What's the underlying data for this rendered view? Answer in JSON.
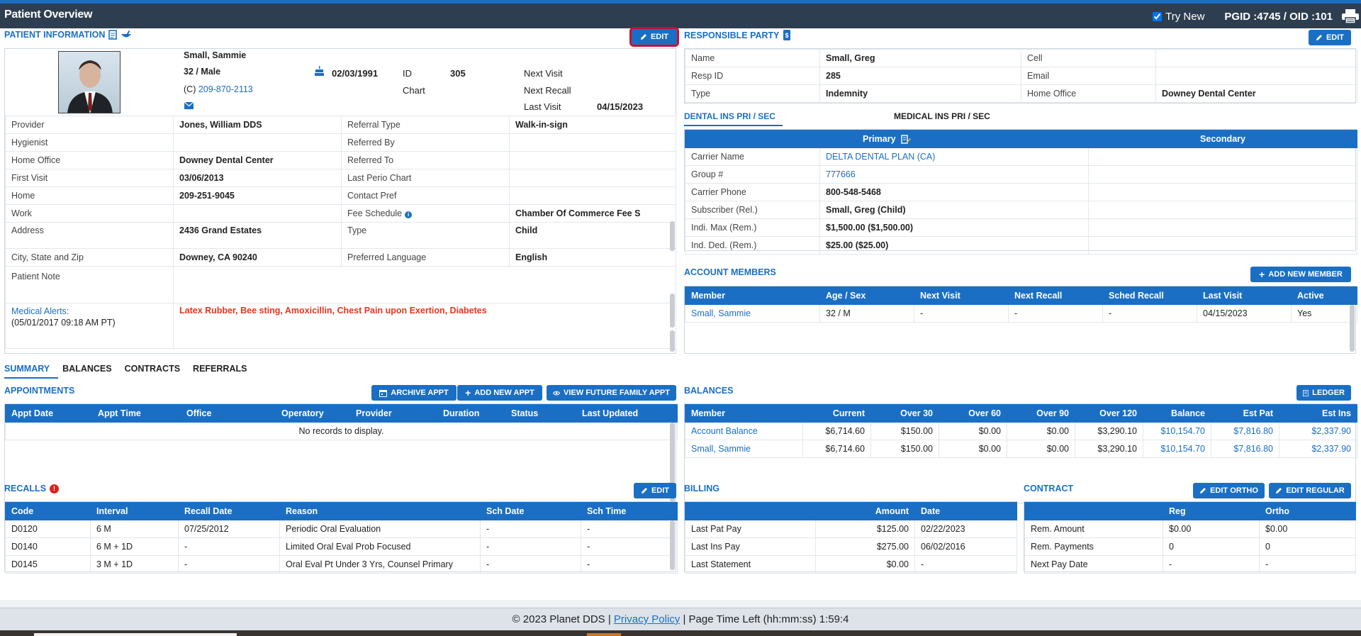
{
  "topbar": {
    "title": "Patient Overview",
    "try_new": "Try New",
    "ids": "PGID :4745  /  OID :101"
  },
  "patient_info": {
    "title": "PATIENT INFORMATION",
    "edit": "EDIT",
    "name": "Small, Sammie",
    "age_sex": "32 / Male",
    "cell_prefix": "(C)",
    "cell": "209-870-2113",
    "dob": "02/03/1991",
    "id_label": "ID",
    "id_value": "305",
    "chart_label": "Chart",
    "next_visit_label": "Next Visit",
    "next_recall_label": "Next Recall",
    "last_visit_label": "Last Visit",
    "last_visit_value": "04/15/2023",
    "rows": [
      [
        "Provider",
        "Jones, William DDS",
        "Referral Type",
        "Walk-in-sign"
      ],
      [
        "Hygienist",
        "",
        "Referred By",
        ""
      ],
      [
        "Home Office",
        "Downey Dental Center",
        "Referred To",
        ""
      ],
      [
        "First Visit",
        "03/06/2013",
        "Last Perio Chart",
        ""
      ],
      [
        "Home",
        "209-251-9045",
        "Contact Pref",
        ""
      ],
      [
        "Work",
        "",
        "Fee Schedule",
        "Chamber Of Commerce Fee S"
      ],
      [
        "Address",
        "2436 Grand Estates",
        "Type",
        "Child"
      ],
      [
        "City, State and Zip",
        "Downey, CA 90240",
        "Preferred Language",
        "English"
      ]
    ],
    "patient_note_label": "Patient Note",
    "medical_alerts_label": "Medical Alerts:",
    "medical_alerts_date": "(05/01/2017 09:18 AM PT)",
    "medical_alerts_value": "Latex Rubber, Bee sting, Amoxicillin, Chest Pain upon Exertion, Diabetes"
  },
  "responsible_party": {
    "title": "RESPONSIBLE PARTY",
    "edit": "EDIT",
    "rows": [
      [
        "Name",
        "Small, Greg",
        "Cell",
        ""
      ],
      [
        "Resp ID",
        "285",
        "Email",
        ""
      ],
      [
        "Type",
        "Indemnity",
        "Home Office",
        "Downey Dental Center"
      ]
    ]
  },
  "insurance": {
    "tab_dental": "DENTAL INS PRI / SEC",
    "tab_medical": "MEDICAL INS PRI / SEC",
    "primary": "Primary",
    "secondary": "Secondary",
    "rows": [
      [
        "Carrier Name",
        "DELTA DENTAL PLAN (CA)"
      ],
      [
        "Group #",
        "777666"
      ],
      [
        "Carrier Phone",
        "800-548-5468"
      ],
      [
        "Subscriber (Rel.)",
        "Small, Greg (Child)"
      ],
      [
        "Indi. Max (Rem.)",
        "$1,500.00 ($1,500.00)"
      ],
      [
        "Ind. Ded. (Rem.)",
        "$25.00 ($25.00)"
      ]
    ]
  },
  "account_members": {
    "title": "ACCOUNT MEMBERS",
    "add_button": "ADD NEW MEMBER",
    "headers": [
      "Member",
      "Age / Sex",
      "Next Visit",
      "Next Recall",
      "Sched Recall",
      "Last Visit",
      "Active"
    ],
    "rows": [
      [
        "Small, Sammie",
        "32 / M",
        "-",
        "-",
        "-",
        "04/15/2023",
        "Yes"
      ]
    ]
  },
  "tabs": [
    "SUMMARY",
    "BALANCES",
    "CONTRACTS",
    "REFERRALS"
  ],
  "appointments": {
    "title": "APPOINTMENTS",
    "archive": "ARCHIVE APPT",
    "add": "ADD NEW APPT",
    "view_future": "VIEW FUTURE FAMILY APPT",
    "headers": [
      "Appt Date",
      "Appt Time",
      "Office",
      "Operatory",
      "Provider",
      "Duration",
      "Status",
      "Last Updated"
    ],
    "empty": "No records to display."
  },
  "balances": {
    "title": "BALANCES",
    "ledger": "LEDGER",
    "headers": [
      "Member",
      "Current",
      "Over 30",
      "Over 60",
      "Over 90",
      "Over 120",
      "Balance",
      "Est Pat",
      "Est Ins"
    ],
    "rows": [
      [
        "Account Balance",
        "$6,714.60",
        "$150.00",
        "$0.00",
        "$0.00",
        "$3,290.10",
        "$10,154.70",
        "$7,816.80",
        "$2,337.90"
      ],
      [
        "Small, Sammie",
        "$6,714.60",
        "$150.00",
        "$0.00",
        "$0.00",
        "$3,290.10",
        "$10,154.70",
        "$7,816.80",
        "$2,337.90"
      ]
    ]
  },
  "recalls": {
    "title": "RECALLS",
    "badge": "!",
    "edit": "EDIT",
    "headers": [
      "Code",
      "Interval",
      "Recall Date",
      "Reason",
      "Sch Date",
      "Sch Time"
    ],
    "rows": [
      [
        "D0120",
        "6 M",
        "07/25/2012",
        "Periodic Oral Evaluation",
        "-",
        "-"
      ],
      [
        "D0140",
        "6 M + 1D",
        "-",
        "Limited Oral Eval Prob Focused",
        "-",
        "-"
      ],
      [
        "D0145",
        "3 M + 1D",
        "-",
        "Oral Eval Pt Under 3 Yrs, Counsel Primary",
        "-",
        "-"
      ]
    ]
  },
  "billing": {
    "title": "BILLING",
    "headers": [
      "",
      "Amount",
      "Date"
    ],
    "rows": [
      [
        "Last Pat Pay",
        "$125.00",
        "02/22/2023"
      ],
      [
        "Last Ins Pay",
        "$275.00",
        "06/02/2016"
      ],
      [
        "Last Statement",
        "$0.00",
        "-"
      ]
    ]
  },
  "contract": {
    "title": "CONTRACT",
    "edit_ortho": "EDIT ORTHO",
    "edit_regular": "EDIT REGULAR",
    "headers": [
      "",
      "Reg",
      "Ortho"
    ],
    "rows": [
      [
        "Rem. Amount",
        "$0.00",
        "$0.00"
      ],
      [
        "Rem. Payments",
        "0",
        "0"
      ],
      [
        "Next Pay Date",
        "-",
        "-"
      ]
    ]
  },
  "footer": {
    "copyright": "© 2023 Planet DDS |",
    "privacy": "Privacy Policy",
    "time_left": "|  Page Time Left (hh:mm:ss) 1:59:4"
  },
  "colors": {
    "accent": "#1a6fc4",
    "header": "#2d3e50",
    "alert": "#e8341c",
    "highlight": "#c8102e"
  }
}
